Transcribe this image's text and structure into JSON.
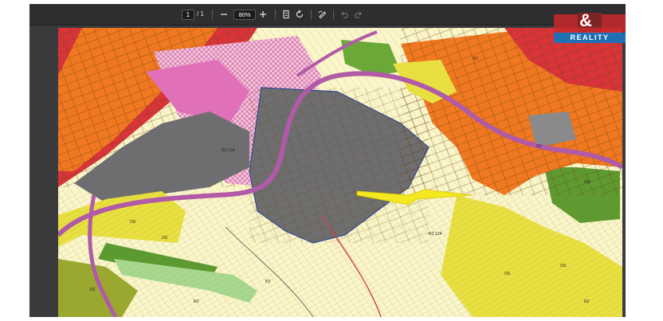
{
  "toolbar": {
    "current_page": "1",
    "page_separator": "/",
    "total_pages": "1",
    "zoom_out_icon": "minus-icon",
    "zoom_value": "80%",
    "zoom_in_icon": "plus-icon",
    "fit_page_icon": "fit-page-icon",
    "rotate_icon": "rotate-icon",
    "draw_icon": "draw-icon",
    "undo_icon": "undo-icon",
    "redo_icon": "redo-icon"
  },
  "map": {
    "labels": [
      "RZ.124",
      "RZ.124",
      "SV",
      "OS",
      "OS",
      "OS",
      "OS",
      "RZ",
      "RZ",
      "PZ",
      "RZ",
      "SV",
      "OS"
    ],
    "colors": {
      "industrial": "#6e6e70",
      "residential": "#f07820",
      "urban_core": "#e03030",
      "green": "#5a9a30",
      "pink_zone": "#e890c8",
      "agriculture": "#fbf6c9",
      "yellow_plots": "#e8e040",
      "road": "#b05aa8"
    }
  },
  "watermark": {
    "symbol": "&",
    "text": "REALITY"
  }
}
